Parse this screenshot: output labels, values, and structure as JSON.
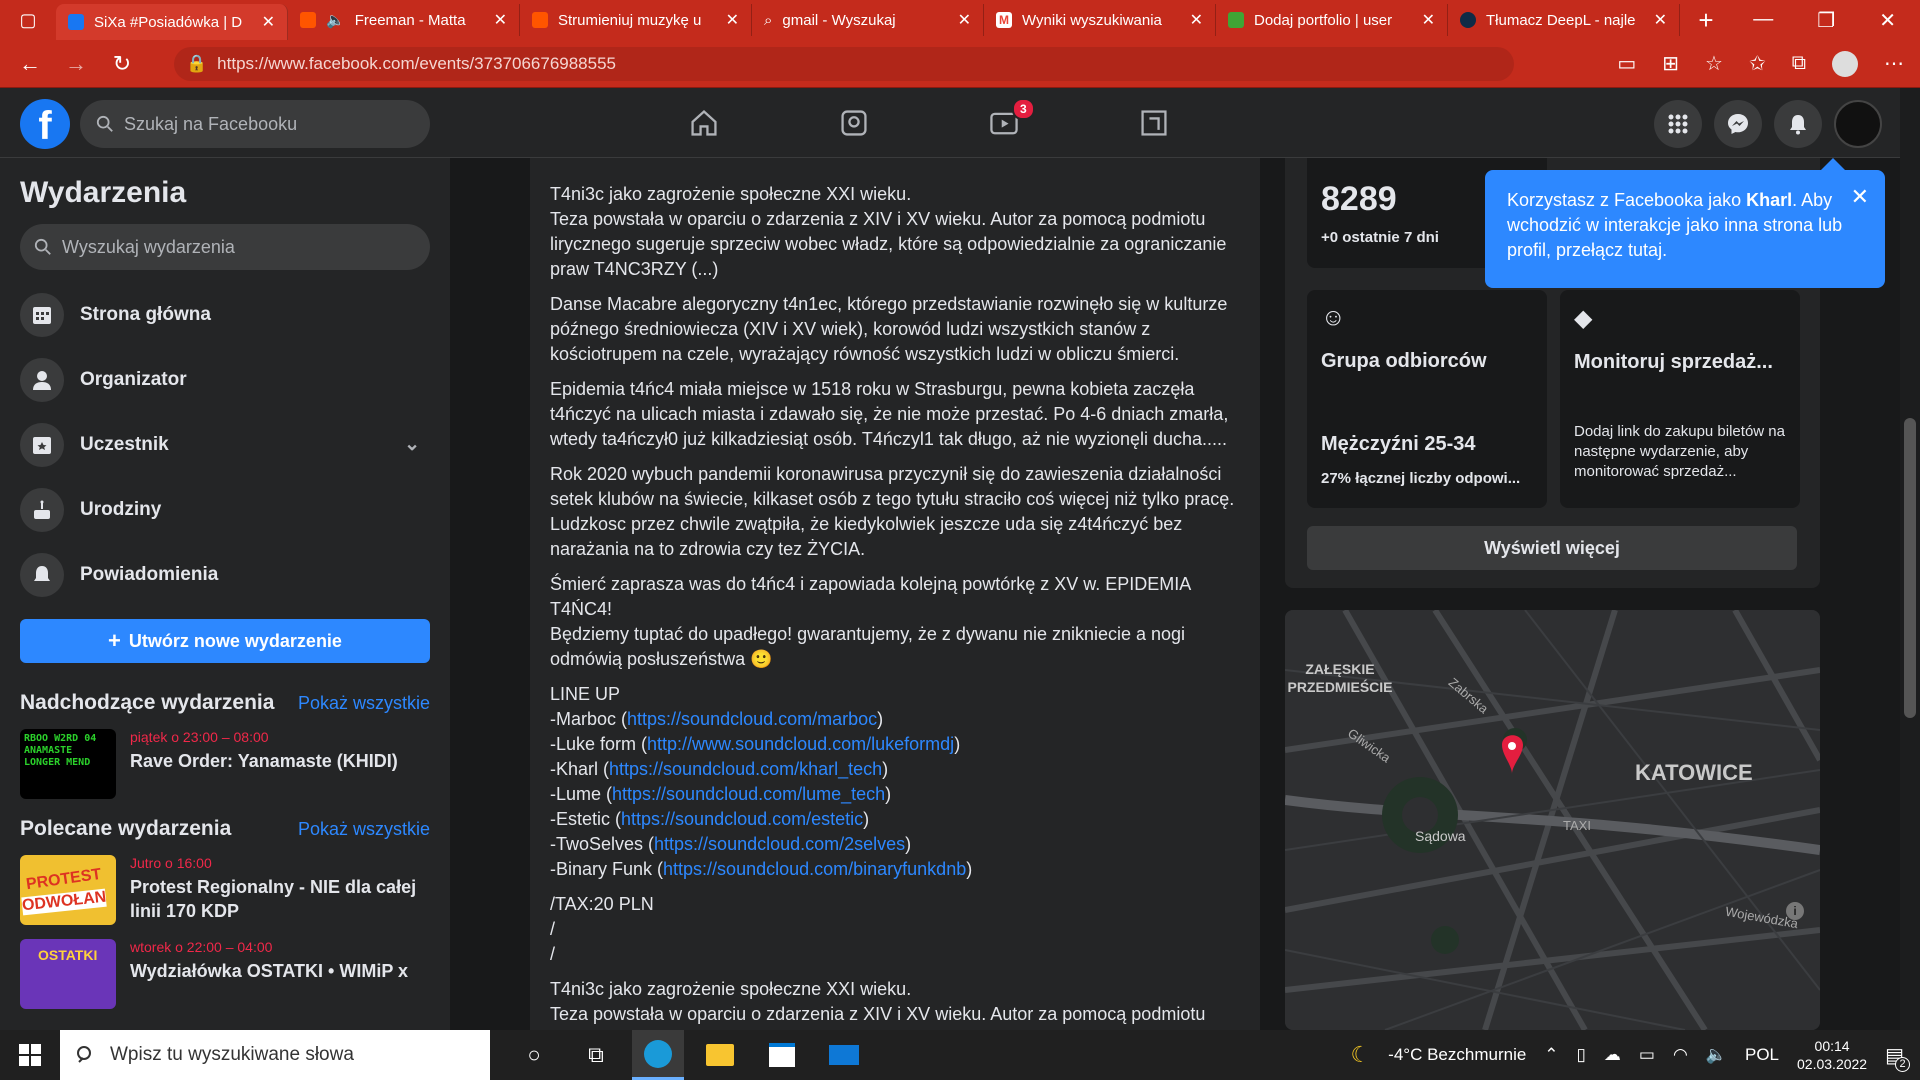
{
  "browser": {
    "tabs": [
      {
        "title": "SiXa #Posiadówka | D",
        "color": "#1877f2"
      },
      {
        "title": "Freeman - Matta",
        "color": "#ff5500"
      },
      {
        "title": "Strumieniuj muzykę u",
        "color": "#ff5500"
      },
      {
        "title": "gmail - Wyszukaj",
        "color": "#888888"
      },
      {
        "title": "Wyniki wyszukiwania",
        "color": "#ea4335"
      },
      {
        "title": "Dodaj portfolio | user",
        "color": "#3fa535"
      },
      {
        "title": "Tłumacz DeepL - najle",
        "color": "#0f2b46"
      }
    ],
    "url": "https://www.facebook.com/events/373706676988555"
  },
  "fb": {
    "search_placeholder": "Szukaj na Facebooku",
    "watch_badge": "3"
  },
  "sidebar": {
    "title": "Wydarzenia",
    "search_placeholder": "Wyszukaj wydarzenia",
    "items": [
      {
        "label": "Strona główna"
      },
      {
        "label": "Organizator"
      },
      {
        "label": "Uczestnik"
      },
      {
        "label": "Urodziny"
      },
      {
        "label": "Powiadomienia"
      }
    ],
    "create_label": "Utwórz nowe wydarzenie",
    "upcoming": {
      "title": "Nadchodzące wydarzenia",
      "show_all": "Pokaż wszystkie",
      "events": [
        {
          "date": "piątek o 23:00 – 08:00",
          "title": "Rave Order: Yanamaste (KHIDI)"
        }
      ]
    },
    "recommended": {
      "title": "Polecane wydarzenia",
      "show_all": "Pokaż wszystkie",
      "events": [
        {
          "date": "Jutro o 16:00",
          "title": "Protest Regionalny - NIE dla całej linii 170 KDP"
        },
        {
          "date": "wtorek o 22:00 – 04:00",
          "title": "Wydziałówka OSTATKI • WIMiP x"
        }
      ]
    }
  },
  "post": {
    "p1": "T4ni3c jako zagrożenie społeczne XXI wieku.\nTeza powstała w oparciu o zdarzenia z XIV i XV wieku. Autor za pomocą podmiotu lirycznego sugeruje sprzeciw wobec władz, które są odpowiedzialnie za ograniczanie praw T4NC3RZY (...)",
    "p2": "Danse Macabre alegoryczny t4n1ec, którego przedstawianie rozwinęło się w kulturze późnego średniowiecza (XIV i XV wiek), korowód ludzi wszystkich stanów z kościotrupem na czele, wyrażający równość wszystkich ludzi w obliczu śmierci.",
    "p3": "Epidemia t4ńc4 miała miejsce w 1518 roku w Strasburgu, pewna kobieta zaczęła t4ńczyć na ulicach miasta i zdawało się, że nie może przestać. Po 4-6 dniach zmarła, wtedy ta4ńczył0 już kilkadziesiąt osób. T4ńczyl1 tak długo, aż nie wyzionęli ducha.....",
    "p4": "Rok 2020 wybuch pandemii koronawirusa przyczynił się do zawieszenia działalności setek klubów na świecie, kilkaset osób z tego tytułu straciło coś więcej niż tylko pracę. Ludzkosc przez chwile zwątpiła, że kiedykolwiek jeszcze uda się z4t4ńczyć bez narażania na to zdrowia czy tez ŻYCIA.",
    "p5": "Śmierć zaprasza was do t4ńc4 i zapowiada kolejną powtórkę z XV w. EPIDEMIA T4ŃC4!\nBędziemy tuptać do upadłego! gwarantujemy, że z dywanu nie znikniecie a nogi odmówią posłuszeństwa 🙂",
    "lineup_title": "LINE UP",
    "lineup": [
      {
        "name": "-Marboc (",
        "url": "https://soundcloud.com/marboc"
      },
      {
        "name": "-Luke form (",
        "url": "http://www.soundcloud.com/lukeformdj"
      },
      {
        "name": "-Kharl (",
        "url": "https://soundcloud.com/kharl_tech"
      },
      {
        "name": "-Lume (",
        "url": "https://soundcloud.com/lume_tech"
      },
      {
        "name": "-Estetic (",
        "url": "https://soundcloud.com/estetic"
      },
      {
        "name": "-TwoSelves (",
        "url": "https://soundcloud.com/2selves"
      },
      {
        "name": "-Binary Funk (",
        "url": "https://soundcloud.com/binaryfunkdnb"
      }
    ],
    "tax": "/TAX:20 PLN\n/\n/",
    "p6": "T4ni3c jako zagrożenie społeczne XXI wieku.\nTeza powstała w oparciu o zdarzenia z XIV i XV wieku. Autor za pomocą podmiotu"
  },
  "insights": {
    "count": "8289",
    "count_sub": "+0 ostatnie 7 dni",
    "audience_title": "Grupa odbiorców",
    "audience_value": "Mężczyźni 25-34",
    "audience_sub": "27% łącznej liczby odpowi...",
    "sales_title": "Monitoruj sprzedaż...",
    "sales_desc": "Dodaj link do zakupu biletów na następne wydarzenie, aby monitorować sprzedaż...",
    "show_more": "Wyświetl więcej"
  },
  "map": {
    "labels": [
      "ZAŁĘSKIE PRZEDMIEŚCIE",
      "Zabrska",
      "Gliwicka",
      "KATOWICE",
      "Sądowa",
      "TAXI",
      "Wojewódzka"
    ]
  },
  "tooltip": {
    "text_pre": "Korzystasz z Facebooka jako ",
    "name": "Kharl",
    "text_post": ". Aby wchodzić w interakcje jako inna strona lub profil, przełącz tutaj."
  },
  "taskbar": {
    "search_placeholder": "Wpisz tu wyszukiwane słowa",
    "weather": "-4°C  Bezchmurnie",
    "lang": "POL",
    "time": "00:14",
    "date": "02.03.2022",
    "notif_count": "2"
  }
}
